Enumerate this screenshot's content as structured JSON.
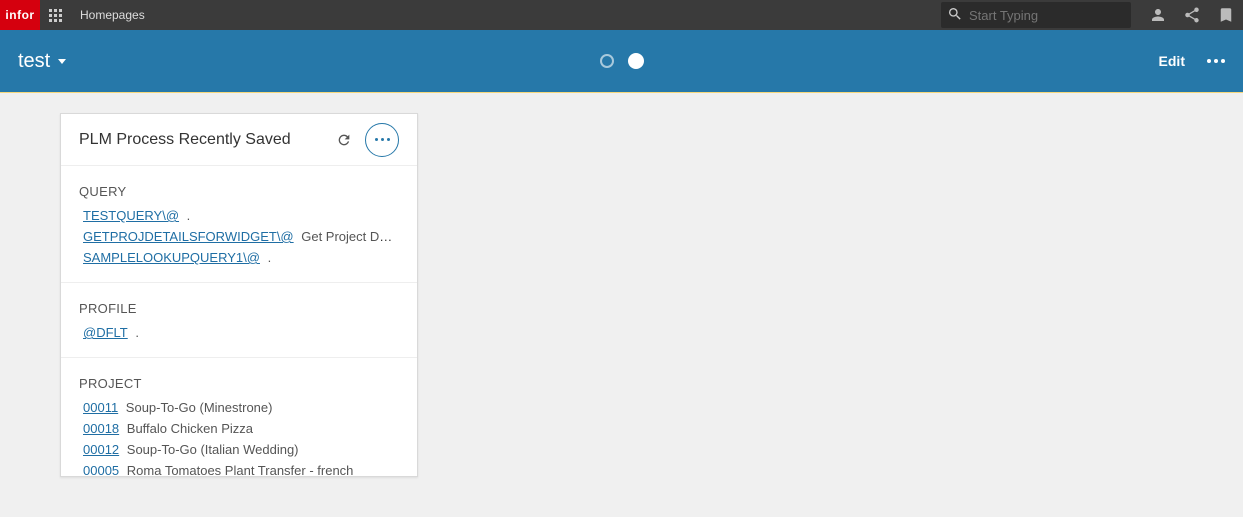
{
  "header": {
    "brand": "infor",
    "title": "Homepages",
    "search_placeholder": "Start Typing"
  },
  "subheader": {
    "page_title": "test",
    "edit_label": "Edit"
  },
  "widget": {
    "title": "PLM Process Recently Saved",
    "groups": [
      {
        "title": "QUERY",
        "rows": [
          {
            "link": "TESTQUERY\\@",
            "desc": "."
          },
          {
            "link": "GETPROJDETAILSFORWIDGET\\@",
            "desc": "Get Project De…"
          },
          {
            "link": "SAMPLELOOKUPQUERY1\\@",
            "desc": "."
          }
        ]
      },
      {
        "title": "PROFILE",
        "rows": [
          {
            "link": "@DFLT",
            "desc": "."
          }
        ]
      },
      {
        "title": "PROJECT",
        "rows": [
          {
            "link": "00011",
            "desc": "Soup-To-Go (Minestrone)"
          },
          {
            "link": "00018",
            "desc": "Buffalo Chicken Pizza"
          },
          {
            "link": "00012",
            "desc": "Soup-To-Go (Italian Wedding)"
          },
          {
            "link": "00005",
            "desc": "Roma Tomatoes Plant Transfer - french"
          }
        ]
      }
    ]
  }
}
